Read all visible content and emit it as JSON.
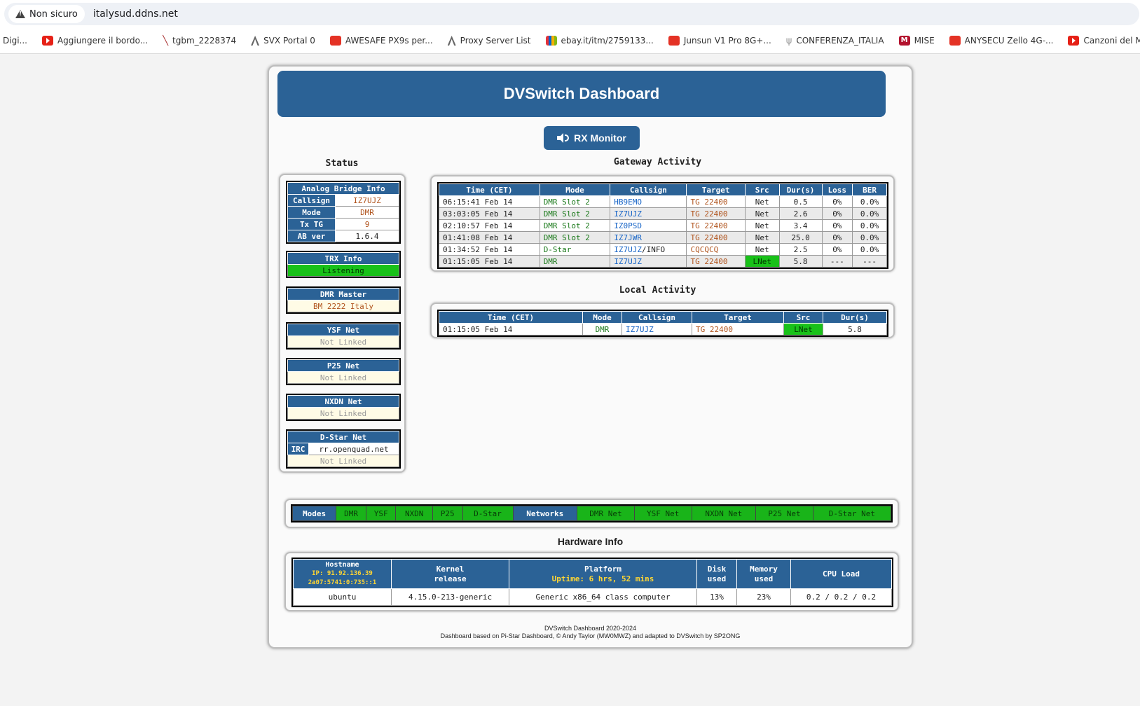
{
  "browser": {
    "security_label": "Non sicuro",
    "url": "italysud.ddns.net",
    "bookmarks": [
      {
        "label": "Digi...",
        "icon": "none"
      },
      {
        "label": "Aggiungere il bordo...",
        "icon": "youtube-icon"
      },
      {
        "label": "tgbm_2228374",
        "icon": "bookmark-icon"
      },
      {
        "label": "SVX Portal 0",
        "icon": "tower-icon"
      },
      {
        "label": "AWESAFE PX9s per...",
        "icon": "aliexpress-icon"
      },
      {
        "label": "Proxy Server List",
        "icon": "tower-icon"
      },
      {
        "label": "ebay.it/itm/2759133...",
        "icon": "ebay-icon"
      },
      {
        "label": "Junsun V1 Pro 8G+...",
        "icon": "aliexpress-icon"
      },
      {
        "label": "CONFERENZA_ITALIA",
        "icon": "antenna-icon"
      },
      {
        "label": "MISE",
        "icon": "mise-icon"
      },
      {
        "label": "ANYSECU Zello 4G-...",
        "icon": "aliexpress-icon"
      },
      {
        "label": "Canzoni del Momen...",
        "icon": "youtube-icon"
      }
    ]
  },
  "dashboard": {
    "title": "DVSwitch Dashboard",
    "rx_monitor_label": "RX Monitor"
  },
  "status": {
    "title": "Status",
    "analog_bridge": {
      "header": "Analog Bridge Info",
      "rows": [
        {
          "label": "Callsign",
          "value": "IZ7UJZ"
        },
        {
          "label": "Mode",
          "value": "DMR"
        },
        {
          "label": "Tx TG",
          "value": "9"
        },
        {
          "label": "AB ver",
          "value": "1.6.4"
        }
      ]
    },
    "trx": {
      "header": "TRX Info",
      "value": "Listening"
    },
    "dmr_master": {
      "header": "DMR Master",
      "value": "BM 2222 Italy"
    },
    "ysf": {
      "header": "YSF Net",
      "value": "Not Linked"
    },
    "p25": {
      "header": "P25 Net",
      "value": "Not Linked"
    },
    "nxdn": {
      "header": "NXDN Net",
      "value": "Not Linked"
    },
    "dstar": {
      "header": "D-Star Net",
      "irc_label": "IRC",
      "irc_value": "rr.openquad.net",
      "value": "Not Linked"
    }
  },
  "gateway": {
    "title": "Gateway Activity",
    "columns": [
      "Time (CET)",
      "Mode",
      "Callsign",
      "Target",
      "Src",
      "Dur(s)",
      "Loss",
      "BER"
    ],
    "rows": [
      {
        "time": "06:15:41 Feb 14",
        "mode": "DMR Slot 2",
        "callsign": "HB9EMO",
        "suffix": "",
        "target": "TG 22400",
        "src": "Net",
        "dur": "0.5",
        "loss": "0%",
        "ber": "0.0%"
      },
      {
        "time": "03:03:05 Feb 14",
        "mode": "DMR Slot 2",
        "callsign": "IZ7UJZ",
        "suffix": "",
        "target": "TG 22400",
        "src": "Net",
        "dur": "2.6",
        "loss": "0%",
        "ber": "0.0%"
      },
      {
        "time": "02:10:57 Feb 14",
        "mode": "DMR Slot 2",
        "callsign": "IZ0PSD",
        "suffix": "",
        "target": "TG 22400",
        "src": "Net",
        "dur": "3.4",
        "loss": "0%",
        "ber": "0.0%"
      },
      {
        "time": "01:41:08 Feb 14",
        "mode": "DMR Slot 2",
        "callsign": "IZ7JWR",
        "suffix": "",
        "target": "TG 22400",
        "src": "Net",
        "dur": "25.0",
        "loss": "0%",
        "ber": "0.0%"
      },
      {
        "time": "01:34:52 Feb 14",
        "mode": "D-Star",
        "callsign": "IZ7UJZ",
        "suffix": "/INFO",
        "target": "CQCQCQ",
        "src": "Net",
        "dur": "2.5",
        "loss": "0%",
        "ber": "0.0%"
      },
      {
        "time": "01:15:05 Feb 14",
        "mode": "DMR",
        "callsign": "IZ7UJZ",
        "suffix": "",
        "target": "TG 22400",
        "src": "LNet",
        "dur": "5.8",
        "loss": "---",
        "ber": "---"
      }
    ]
  },
  "local": {
    "title": "Local Activity",
    "columns": [
      "Time (CET)",
      "Mode",
      "Callsign",
      "Target",
      "Src",
      "Dur(s)"
    ],
    "rows": [
      {
        "time": "01:15:05 Feb 14",
        "mode": "DMR",
        "callsign": "IZ7UJZ",
        "target": "TG 22400",
        "src": "LNet",
        "dur": "5.8"
      }
    ]
  },
  "modes_bar": {
    "modes_label": "Modes",
    "modes": [
      "DMR",
      "YSF",
      "NXDN",
      "P25",
      "D-Star"
    ],
    "networks_label": "Networks",
    "networks": [
      "DMR Net",
      "YSF Net",
      "NXDN Net",
      "P25 Net",
      "D-Star Net"
    ]
  },
  "hardware": {
    "title": "Hardware Info",
    "hostname_header": "Hostname",
    "ip_v4": "IP: 91.92.136.39",
    "ip_v6": "2a07:5741:0:735::1",
    "kernel_header_1": "Kernel",
    "kernel_header_2": "release",
    "platform_header": "Platform",
    "uptime": "Uptime: 6 hrs, 52 mins",
    "disk_header_1": "Disk",
    "disk_header_2": "used",
    "memory_header_1": "Memory",
    "memory_header_2": "used",
    "cpu_header": "CPU Load",
    "hostname": "ubuntu",
    "kernel": "4.15.0-213-generic",
    "platform": "Generic x86_64 class computer",
    "disk": "13%",
    "memory": "23%",
    "cpu": "0.2 / 0.2 / 0.2"
  },
  "footer": {
    "line1": "DVSwitch Dashboard 2020-2024",
    "line2": "Dashboard based on Pi-Star Dashboard, © Andy Taylor (MW0MWZ) and adapted to DVSwitch by SP2ONG"
  },
  "colors": {
    "header_blue": "#2b6296",
    "active_green": "#19c119",
    "target_orange": "#b0531c",
    "callsign_blue": "#1664c7"
  }
}
